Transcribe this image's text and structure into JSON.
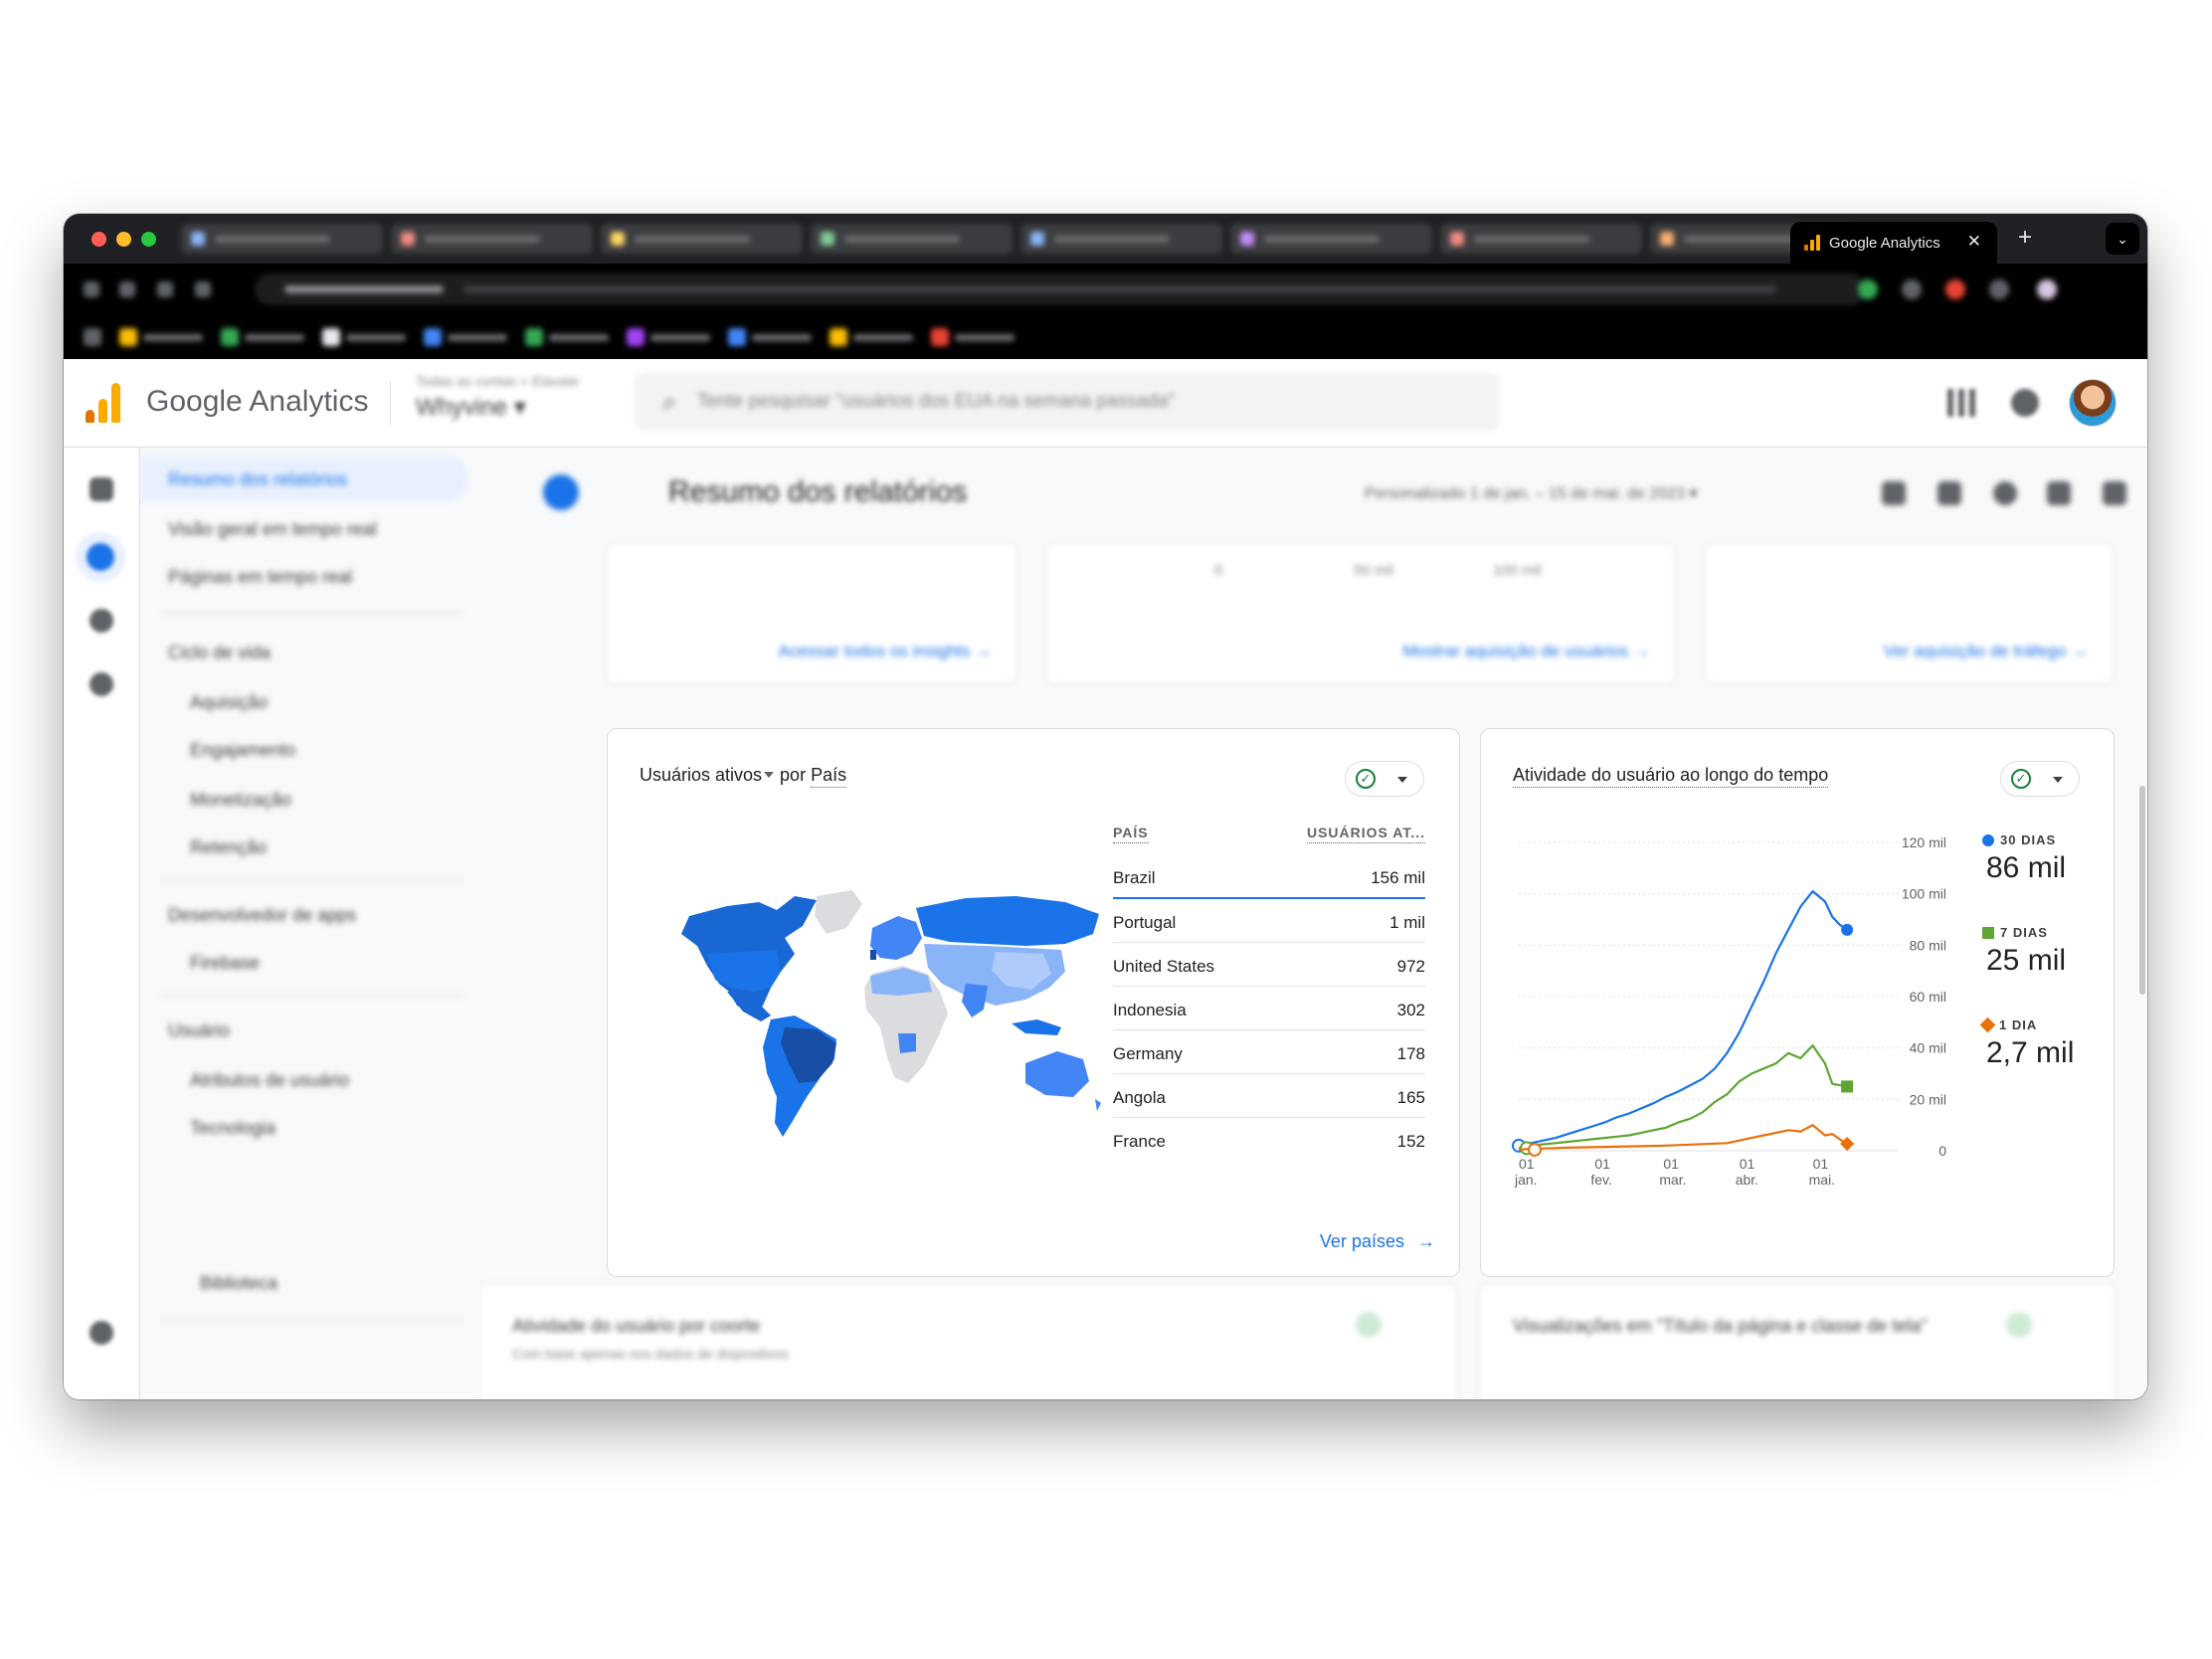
{
  "browser": {
    "active_tab_title": "Google Analytics",
    "tab_close": "✕",
    "new_tab": "+",
    "tab_menu": "⌄"
  },
  "header": {
    "product_name": "Google Analytics",
    "account_line": "Todas as contas > Elavate",
    "property_name": "Whyvine ▾",
    "search_placeholder": "Tente pesquisar \"usuários dos EUA na semana passada\""
  },
  "nav": {
    "items": [
      "Resumo dos relatórios",
      "Visão geral em tempo real",
      "Páginas em tempo real",
      "Ciclo de vida",
      "Aquisição",
      "Engajamento",
      "Monetização",
      "Retenção",
      "Desenvolvedor de apps",
      "Firebase",
      "Usuário",
      "Atributos de usuário",
      "Tecnologia",
      "Biblioteca"
    ]
  },
  "page": {
    "title": "Resumo dos relatórios",
    "date_range": "Personalizado   1 de jan. – 15 de mai. de 2023  ▾"
  },
  "top_cards": {
    "link1": "Acessar todos os insights  →",
    "link2": "Mostrar aquisição de usuários  →",
    "link3": "Ver aquisição de tráfego  →",
    "ticks": [
      "0",
      "50 mil",
      "100 mil"
    ]
  },
  "country_card": {
    "title_metric": "Usuários ativos",
    "title_by": "por",
    "title_dim": "País",
    "col_country": "PAÍS",
    "col_users": "USUÁRIOS AT...",
    "rows": [
      {
        "country": "Brazil",
        "users": "156 mil"
      },
      {
        "country": "Portugal",
        "users": "1 mil"
      },
      {
        "country": "United States",
        "users": "972"
      },
      {
        "country": "Indonesia",
        "users": "302"
      },
      {
        "country": "Germany",
        "users": "178"
      },
      {
        "country": "Angola",
        "users": "165"
      },
      {
        "country": "France",
        "users": "152"
      }
    ],
    "link": "Ver países",
    "link_arrow": "→"
  },
  "activity_card": {
    "title": "Atividade do usuário ao longo do tempo",
    "legend": [
      {
        "label": "30 DIAS",
        "value": "86 mil",
        "color": "#1a73e8"
      },
      {
        "label": "7 DIAS",
        "value": "25 mil",
        "color": "#5fa532"
      },
      {
        "label": "1 DIA",
        "value": "2,7 mil",
        "color": "#e8710a"
      }
    ]
  },
  "chart_data": {
    "type": "line",
    "title": "Atividade do usuário ao longo do tempo",
    "x_ticks": [
      {
        "day": "01",
        "month": "jan."
      },
      {
        "day": "01",
        "month": "fev."
      },
      {
        "day": "01",
        "month": "mar."
      },
      {
        "day": "01",
        "month": "abr."
      },
      {
        "day": "01",
        "month": "mai."
      }
    ],
    "y_ticks": [
      "0",
      "20 mil",
      "40 mil",
      "60 mil",
      "80 mil",
      "100 mil",
      "120 mil"
    ],
    "ylim": [
      0,
      120000
    ],
    "x_unit": "days since 01 jan.",
    "series": [
      {
        "name": "30 DIAS",
        "color": "#1a73e8",
        "x": [
          0,
          5,
          10,
          15,
          20,
          25,
          30,
          35,
          40,
          45,
          50,
          55,
          60,
          65,
          70,
          75,
          80,
          85,
          90,
          95,
          100,
          105,
          110,
          115,
          120,
          125,
          128,
          131,
          134
        ],
        "y": [
          2000,
          3000,
          4000,
          5000,
          6500,
          8000,
          9500,
          11000,
          13000,
          14500,
          16500,
          18500,
          21000,
          23000,
          25500,
          28000,
          32000,
          38000,
          46000,
          56000,
          66000,
          77000,
          86000,
          95000,
          101000,
          97000,
          91000,
          88000,
          86000
        ]
      },
      {
        "name": "7 DIAS",
        "color": "#5fa532",
        "x": [
          0,
          5,
          10,
          15,
          20,
          25,
          30,
          35,
          40,
          45,
          50,
          55,
          60,
          65,
          70,
          75,
          80,
          85,
          90,
          95,
          100,
          105,
          110,
          115,
          120,
          125,
          128,
          131,
          134
        ],
        "y": [
          1000,
          2000,
          2500,
          3000,
          3500,
          4000,
          4500,
          5000,
          5500,
          6000,
          7000,
          8000,
          9000,
          11000,
          12500,
          15000,
          19000,
          22000,
          27000,
          30000,
          32000,
          34000,
          38000,
          36000,
          41000,
          34000,
          26000,
          25500,
          25000
        ]
      },
      {
        "name": "1 DIA",
        "color": "#e8710a",
        "x": [
          0,
          5,
          10,
          15,
          20,
          25,
          30,
          35,
          40,
          45,
          50,
          55,
          60,
          65,
          70,
          75,
          80,
          85,
          90,
          95,
          100,
          105,
          110,
          115,
          120,
          125,
          128,
          131,
          134
        ],
        "y": [
          400,
          800,
          900,
          1000,
          1200,
          1300,
          1400,
          1500,
          1600,
          1700,
          1800,
          1900,
          2000,
          2200,
          2400,
          2600,
          2800,
          3000,
          4000,
          5000,
          6000,
          7000,
          8000,
          7500,
          10000,
          6000,
          6500,
          4500,
          2700
        ]
      }
    ]
  },
  "bottom_cards": {
    "card1_title": "Atividade do usuário por coorte",
    "card1_sub": "Com base apenas nos dados de dispositivos",
    "card2_title": "Visualizações em \"Título da página e classe de tela\""
  }
}
